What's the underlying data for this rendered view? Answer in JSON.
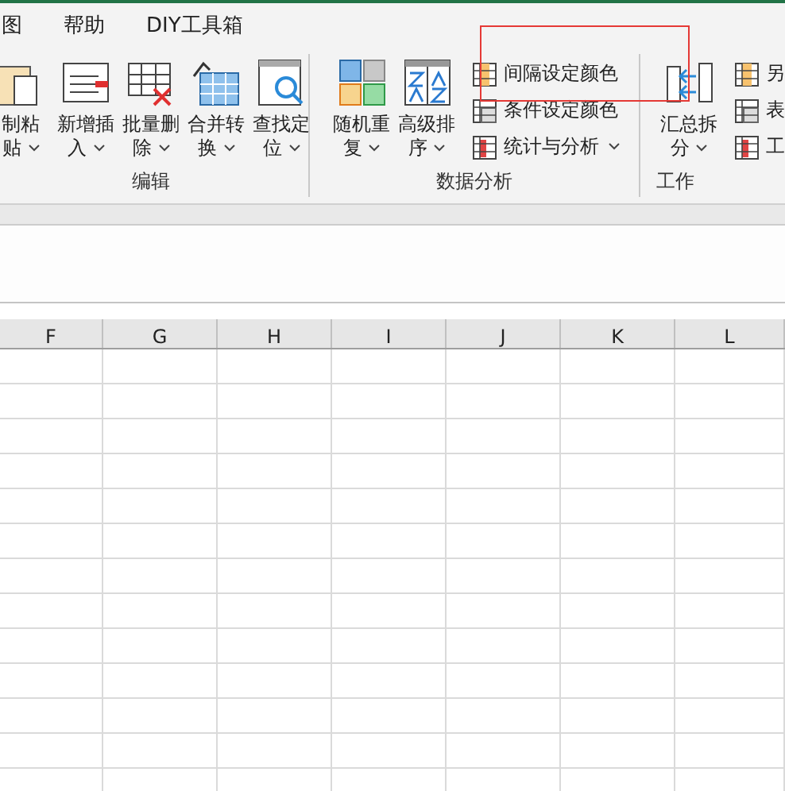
{
  "tabs": [
    {
      "label": "图"
    },
    {
      "label": "帮助"
    },
    {
      "label": "DIY工具箱"
    }
  ],
  "groups": [
    {
      "label": "编辑",
      "large": [
        {
          "lines": [
            "制粘",
            "贴"
          ],
          "dropdown": true
        },
        {
          "lines": [
            "新增插",
            "入"
          ],
          "dropdown": true
        },
        {
          "lines": [
            "批量删",
            "除"
          ],
          "dropdown": true
        },
        {
          "lines": [
            "合并转",
            "换"
          ],
          "dropdown": true
        },
        {
          "lines": [
            "查找定",
            "位"
          ],
          "dropdown": true
        }
      ]
    },
    {
      "label": "数据分析",
      "large": [
        {
          "lines": [
            "随机重",
            "复"
          ],
          "dropdown": true
        },
        {
          "lines": [
            "高级排",
            "序"
          ],
          "dropdown": true
        }
      ],
      "small": [
        {
          "label": "间隔设定颜色",
          "dropdown": false
        },
        {
          "label": "条件设定颜色",
          "dropdown": false
        },
        {
          "label": "统计与分析",
          "dropdown": true
        }
      ]
    },
    {
      "label": "工作",
      "large": [
        {
          "lines": [
            "汇总拆",
            "分"
          ],
          "dropdown": true
        }
      ],
      "small": [
        {
          "label": "另",
          "dropdown": false
        },
        {
          "label": "表",
          "dropdown": false
        },
        {
          "label": "工",
          "dropdown": false
        }
      ]
    }
  ],
  "columns": [
    "F",
    "G",
    "H",
    "I",
    "J",
    "K",
    "L"
  ]
}
